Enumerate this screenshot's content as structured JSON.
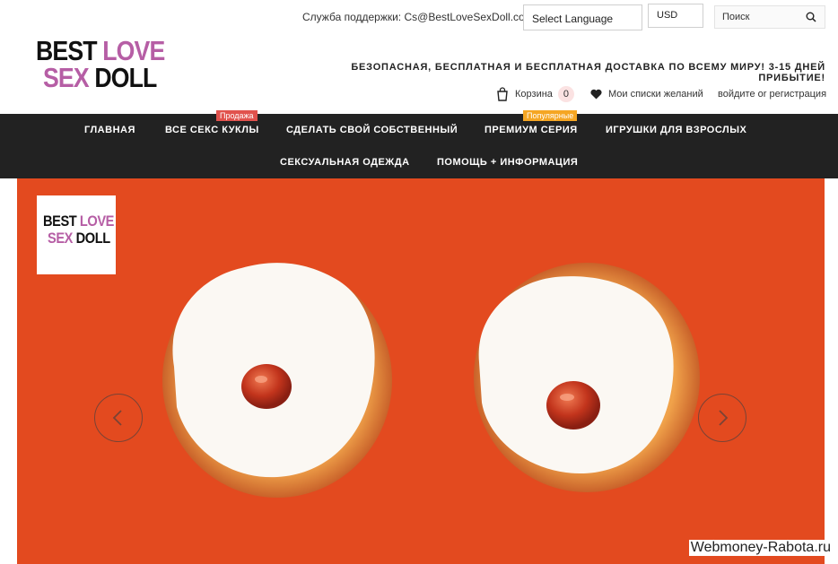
{
  "topbar": {
    "support": "Служба поддержки: Cs@BestLoveSexDoll.com",
    "language": "Select Language",
    "currency": "USD",
    "search_placeholder": "Поиск"
  },
  "logo": {
    "line1_dark": "BEST",
    "line1_pink": "LOVE",
    "line2_pink": "SEX",
    "line2_dark": "DOLL"
  },
  "promo": "БЕЗОПАСНАЯ, БЕСПЛАТНАЯ И БЕСПЛАТНАЯ ДОСТАВКА ПО ВСЕМУ МИРУ! 3-15 ДНЕЙ ПРИБЫТИЕ!",
  "usernav": {
    "cart": "Корзина",
    "cart_count": "0",
    "wishlist": "Мои списки желаний",
    "login": "войдите or регистрация"
  },
  "menu": {
    "home": "ГЛАВНАЯ",
    "all_dolls": "ВСЕ СЕКС КУКЛЫ",
    "all_dolls_badge": "Продажа",
    "custom": "СДЕЛАТЬ СВОЙ СОБСТВЕННЫЙ",
    "premium": "ПРЕМИУМ СЕРИЯ",
    "premium_badge": "Популярные",
    "toys": "ИГРУШКИ ДЛЯ ВЗРОСЛЫХ",
    "clothing": "СЕКСУАЛЬНАЯ ОДЕЖДА",
    "help": "ПОМОЩЬ + ИНФОРМАЦИЯ"
  },
  "hero": {
    "background": "#e34a1f"
  },
  "watermark": "Webmoney-Rabota.ru",
  "colors": {
    "accent_pink": "#b65ea5",
    "menu_bg": "#222222",
    "badge_sale": "#e1524d",
    "badge_popular": "#f5a623"
  },
  "icons": [
    "search-icon",
    "cart-icon",
    "heart-icon",
    "chevron-left-icon",
    "chevron-right-icon"
  ]
}
